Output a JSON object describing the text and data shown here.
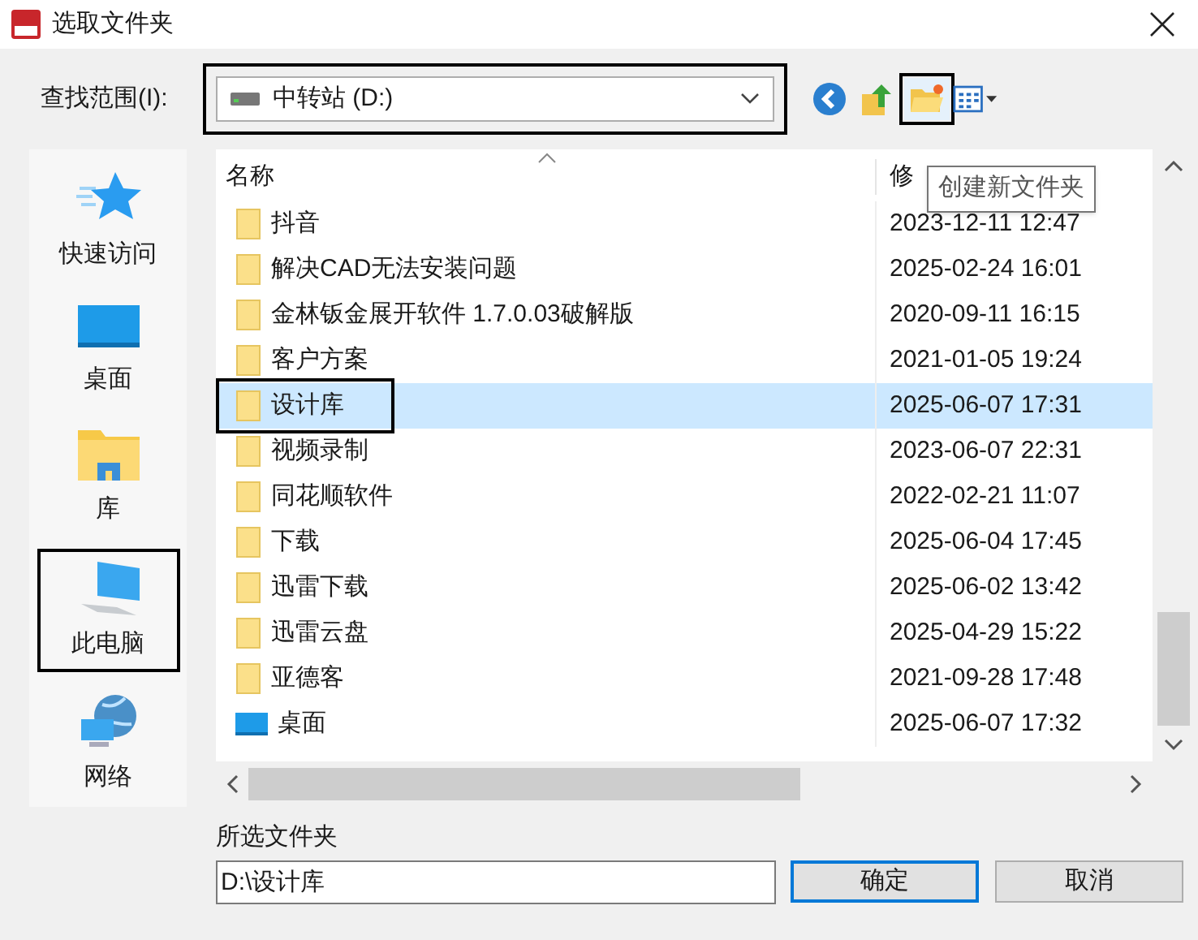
{
  "window": {
    "title": "选取文件夹"
  },
  "look_in": {
    "label": "查找范围(I):",
    "value": "中转站 (D:)",
    "highlighted": true
  },
  "toolbar": [
    {
      "kind": "back",
      "highlighted": false
    },
    {
      "kind": "up",
      "highlighted": false
    },
    {
      "kind": "new-folder",
      "highlighted": true
    },
    {
      "kind": "view-menu",
      "highlighted": false
    }
  ],
  "tooltip": "创建新文件夹",
  "sidebar": {
    "items": [
      {
        "kind": "quick-access",
        "label": "快速访问",
        "highlighted": false
      },
      {
        "kind": "desktop",
        "label": "桌面",
        "highlighted": false
      },
      {
        "kind": "library",
        "label": "库",
        "highlighted": false
      },
      {
        "kind": "pc",
        "label": "此电脑",
        "highlighted": true
      },
      {
        "kind": "network",
        "label": "网络",
        "highlighted": false
      }
    ]
  },
  "table": {
    "columns": [
      "名称",
      "修"
    ],
    "rows": [
      {
        "kind": "folder",
        "name": "抖音",
        "date": "2023-12-11 12:47",
        "selected": false,
        "highlighted": false
      },
      {
        "kind": "folder",
        "name": "解决CAD无法安装问题",
        "date": "2025-02-24 16:01",
        "selected": false,
        "highlighted": false
      },
      {
        "kind": "folder",
        "name": "金林钣金展开软件 1.7.0.03破解版",
        "date": "2020-09-11 16:15",
        "selected": false,
        "highlighted": false
      },
      {
        "kind": "folder",
        "name": "客户方案",
        "date": "2021-01-05 19:24",
        "selected": false,
        "highlighted": false
      },
      {
        "kind": "folder",
        "name": "设计库",
        "date": "2025-06-07 17:31",
        "selected": true,
        "highlighted": true
      },
      {
        "kind": "folder",
        "name": "视频录制",
        "date": "2023-06-07 22:31",
        "selected": false,
        "highlighted": false
      },
      {
        "kind": "folder",
        "name": "同花顺软件",
        "date": "2022-02-21 11:07",
        "selected": false,
        "highlighted": false
      },
      {
        "kind": "folder",
        "name": "下载",
        "date": "2025-06-04 17:45",
        "selected": false,
        "highlighted": false
      },
      {
        "kind": "folder",
        "name": "迅雷下载",
        "date": "2025-06-02 13:42",
        "selected": false,
        "highlighted": false
      },
      {
        "kind": "folder",
        "name": "迅雷云盘",
        "date": "2025-04-29 15:22",
        "selected": false,
        "highlighted": false
      },
      {
        "kind": "folder",
        "name": "亚德客",
        "date": "2021-09-28 17:48",
        "selected": false,
        "highlighted": false
      },
      {
        "kind": "desktop",
        "name": "桌面",
        "date": "2025-06-07 17:32",
        "selected": false,
        "highlighted": false
      }
    ]
  },
  "selected_folder": {
    "label": "所选文件夹",
    "value": "D:\\设计库"
  },
  "buttons": [
    {
      "label": "确定",
      "default": true
    },
    {
      "label": "取消",
      "default": false
    }
  ]
}
